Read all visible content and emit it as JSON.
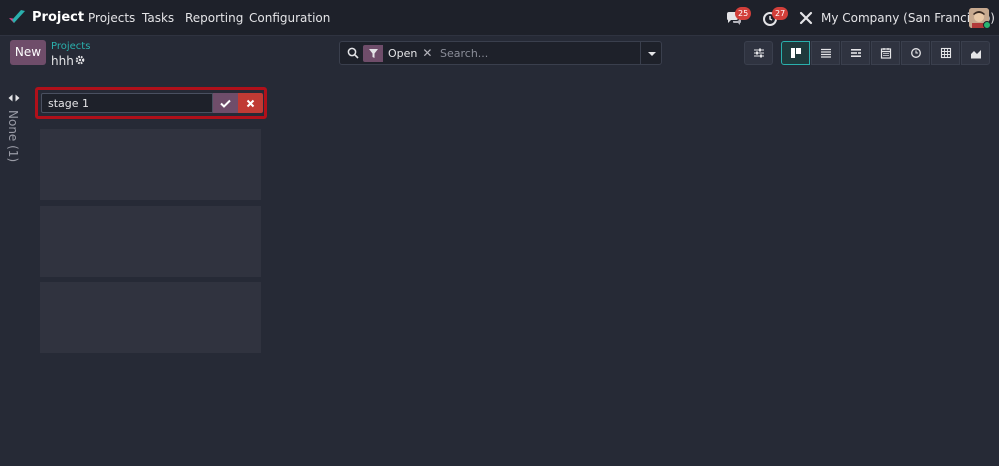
{
  "app": {
    "name": "Project"
  },
  "menu": [
    "Projects",
    "Tasks",
    "Reporting",
    "Configuration"
  ],
  "systray": {
    "messages_count": "25",
    "activities_count": "27",
    "company": "My Company (San Francisco)"
  },
  "control_panel": {
    "new_label": "New",
    "breadcrumb_parent": "Projects",
    "breadcrumb_current": "hhh",
    "facet_label": "Open",
    "facet_remove": "✕",
    "search_placeholder": "Search..."
  },
  "views": [
    {
      "icon": "kanban-icon",
      "active": true
    },
    {
      "icon": "list-icon",
      "active": false
    },
    {
      "icon": "gantt-icon",
      "active": false
    },
    {
      "icon": "calendar-icon",
      "active": false
    },
    {
      "icon": "activity-icon",
      "active": false
    },
    {
      "icon": "pivot-icon",
      "active": false
    },
    {
      "icon": "graph-icon",
      "active": false
    }
  ],
  "kanban": {
    "folded_column_label": "None (1)",
    "quick_create_value": "stage 1"
  },
  "colors": {
    "accent": "#6f4d6a",
    "teal": "#2ab0ad",
    "danger": "#c03a34",
    "badge": "#d23f3a",
    "highlight_border": "#b0101a"
  }
}
